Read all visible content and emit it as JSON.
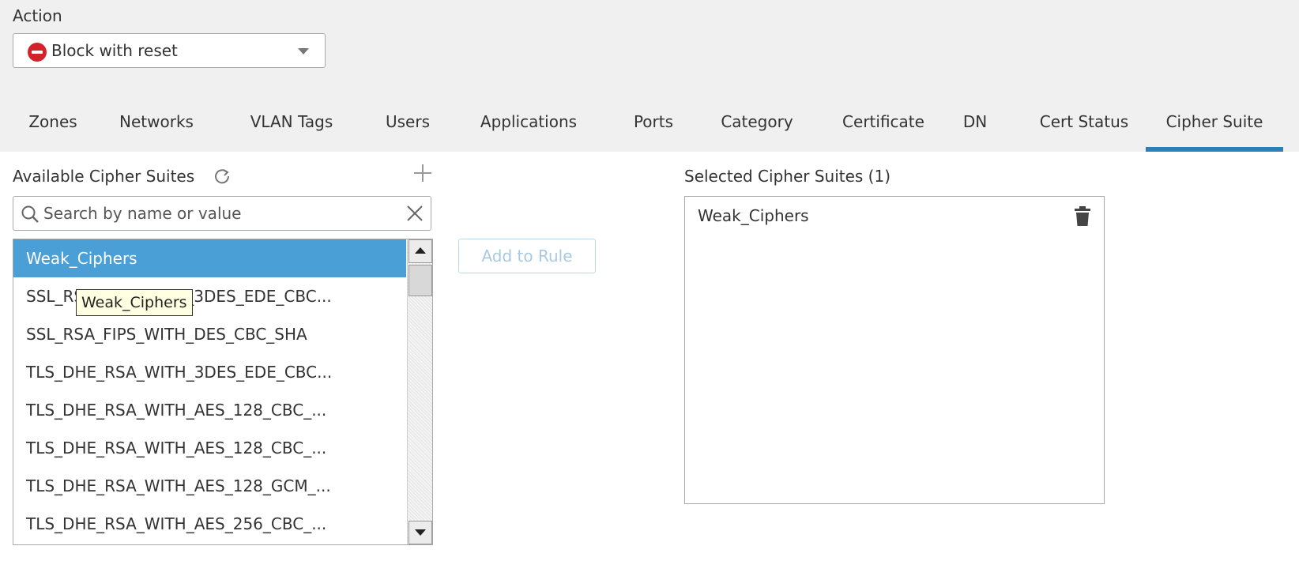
{
  "action": {
    "label": "Action",
    "value": "Block with reset",
    "icon": "block-icon",
    "icon_color": "#d2232a"
  },
  "tabs": [
    {
      "label": "Zones"
    },
    {
      "label": "Networks"
    },
    {
      "label": "VLAN Tags"
    },
    {
      "label": "Users"
    },
    {
      "label": "Applications"
    },
    {
      "label": "Ports"
    },
    {
      "label": "Category"
    },
    {
      "label": "Certificate"
    },
    {
      "label": "DN"
    },
    {
      "label": "Cert Status"
    },
    {
      "label": "Cipher Suite"
    }
  ],
  "active_tab": "Cipher Suite",
  "accent_color": "#2d7fb8",
  "available": {
    "label": "Available Cipher Suites",
    "search_placeholder": "Search by name or value",
    "items": [
      "Weak_Ciphers",
      "SSL_RSA_FIPS_WITH_3DES_EDE_CBC...",
      "SSL_RSA_FIPS_WITH_DES_CBC_SHA",
      "TLS_DHE_RSA_WITH_3DES_EDE_CBC...",
      "TLS_DHE_RSA_WITH_AES_128_CBC_...",
      "TLS_DHE_RSA_WITH_AES_128_CBC_...",
      "TLS_DHE_RSA_WITH_AES_128_GCM_...",
      "TLS_DHE_RSA_WITH_AES_256_CBC_..."
    ],
    "selected_item": "Weak_Ciphers",
    "selected_color": "#4a9fd6",
    "tooltip": "Weak_Ciphers"
  },
  "add_button": {
    "label": "Add to Rule"
  },
  "selected": {
    "label": "Selected Cipher Suites (1)",
    "items": [
      "Weak_Ciphers"
    ]
  }
}
